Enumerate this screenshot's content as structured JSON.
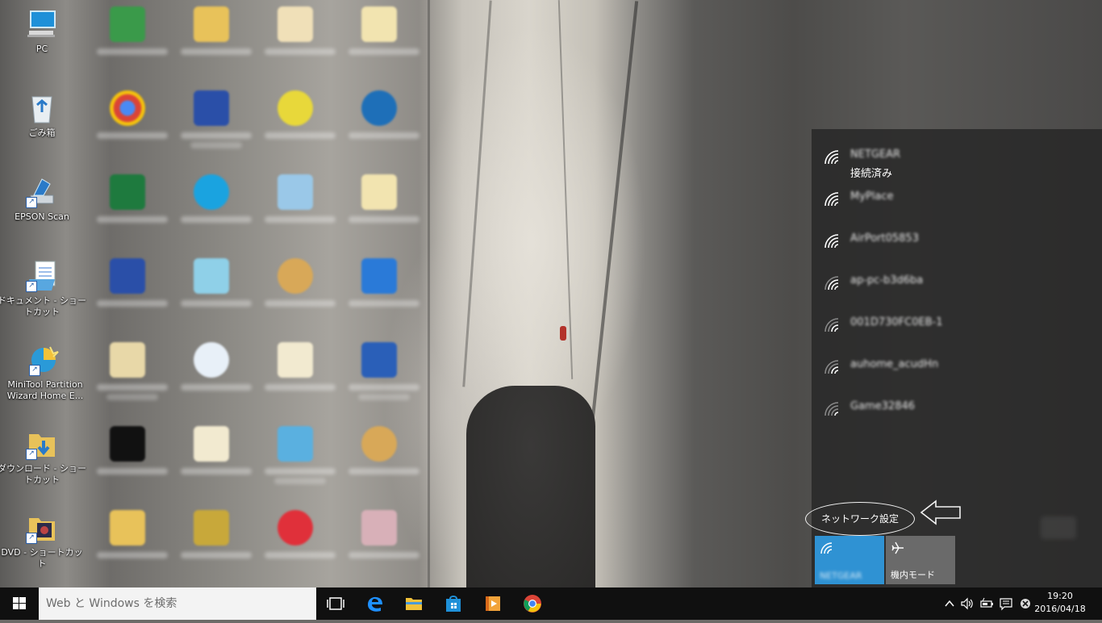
{
  "desktop": {
    "icons": [
      {
        "label": "PC",
        "icon": "computer-icon"
      },
      {
        "label": "ごみ箱",
        "icon": "recycle-bin-icon"
      },
      {
        "label": "EPSON Scan",
        "icon": "scanner-icon"
      },
      {
        "label": "ドキュメント - ショートカット",
        "icon": "document-icon"
      },
      {
        "label": "MiniTool Partition Wizard Home E...",
        "icon": "minitool-icon"
      },
      {
        "label": "ダウンロード - ショートカット",
        "icon": "download-folder-icon"
      },
      {
        "label": "DVD - ショートカット",
        "icon": "dvd-icon"
      }
    ]
  },
  "flyout": {
    "networks": [
      {
        "ssid": "NETGEAR",
        "status": "接続済み",
        "obscured": true
      },
      {
        "ssid": "MyPlace",
        "status": "",
        "obscured": true
      },
      {
        "ssid": "AirPort05853",
        "status": "",
        "obscured": true
      },
      {
        "ssid": "ap-pc-b3d6ba",
        "status": "",
        "obscured": true
      },
      {
        "ssid": "001D730FC0EB-1",
        "status": "",
        "obscured": true
      },
      {
        "ssid": "auhome_acudHn",
        "status": "",
        "obscured": true
      },
      {
        "ssid": "Game32846",
        "status": "",
        "obscured": true
      }
    ],
    "settings_link": "ネットワーク設定",
    "tiles": {
      "wifi_label": "NETGEAR",
      "airplane_label": "機内モード"
    }
  },
  "taskbar": {
    "search_placeholder": "Web と Windows を検索",
    "pinned": [
      "task-view-icon",
      "edge-icon",
      "file-explorer-icon",
      "store-icon",
      "media-player-icon",
      "chrome-icon"
    ],
    "clock_time": "19:20",
    "clock_date": "2016/04/18"
  },
  "colors": {
    "accent": "#2f92d3",
    "taskbar": "#101010",
    "flyout_bg": "#262626"
  }
}
